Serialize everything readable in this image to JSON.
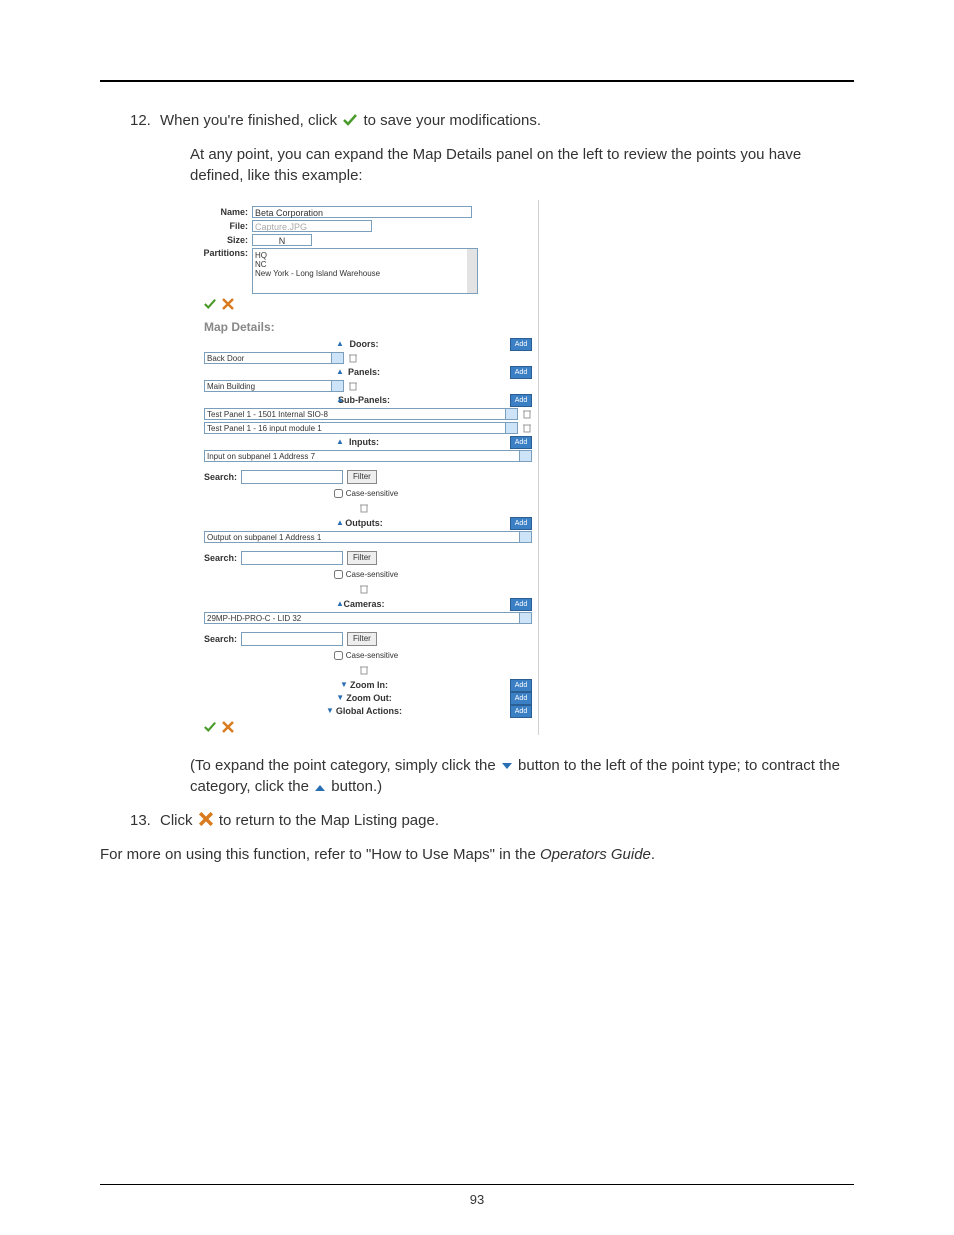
{
  "page_number": "93",
  "steps": {
    "s12": {
      "num": "12.",
      "text_a": "When you're finished, click ",
      "text_b": " to save your modifications."
    },
    "s13": {
      "num": "13.",
      "text_a": "Click ",
      "text_b": " to return to the Map Listing page."
    }
  },
  "para_expand": "At any point, you can expand the Map Details panel on the left to review the points you have defined, like this example:",
  "para_caption_a": "(To expand the point category, simply click the ",
  "para_caption_b": " button to the left of the point type; to contract the category, click the ",
  "para_caption_c": " button.)",
  "para_more_a": "For more on using this function, refer to \"How to Use Maps\" in the ",
  "para_more_guide": "Operators Guide",
  "para_more_b": ".",
  "figure": {
    "labels": {
      "name": "Name:",
      "file": "File:",
      "size": "Size:",
      "partitions": "Partitions:",
      "map_details": "Map Details:",
      "doors": "Doors:",
      "panels": "Panels:",
      "subpanels": "Sub-Panels:",
      "inputs": "Inputs:",
      "outputs": "Outputs:",
      "cameras": "Cameras:",
      "zoom_in": "Zoom In:",
      "zoom_out": "Zoom Out:",
      "global_actions": "Global Actions:",
      "search": "Search:",
      "case_sensitive": "Case-sensitive",
      "filter": "Filter",
      "add": "Add"
    },
    "values": {
      "name": "Beta Corporation",
      "file": "Capture.JPG",
      "size": "N",
      "partitions": [
        "HQ",
        "NC",
        "New York - Long Island Warehouse"
      ],
      "doors": "Back Door",
      "panels": "Main Building",
      "subpanel1": "Test Panel 1 - 1501 Internal SIO-8",
      "subpanel2": "Test Panel 1 - 16 input module 1",
      "inputs": "Input on subpanel 1 Address 7",
      "outputs": "Output on subpanel 1 Address 1",
      "cameras": "29MP-HD-PRO-C - LID 32"
    }
  }
}
